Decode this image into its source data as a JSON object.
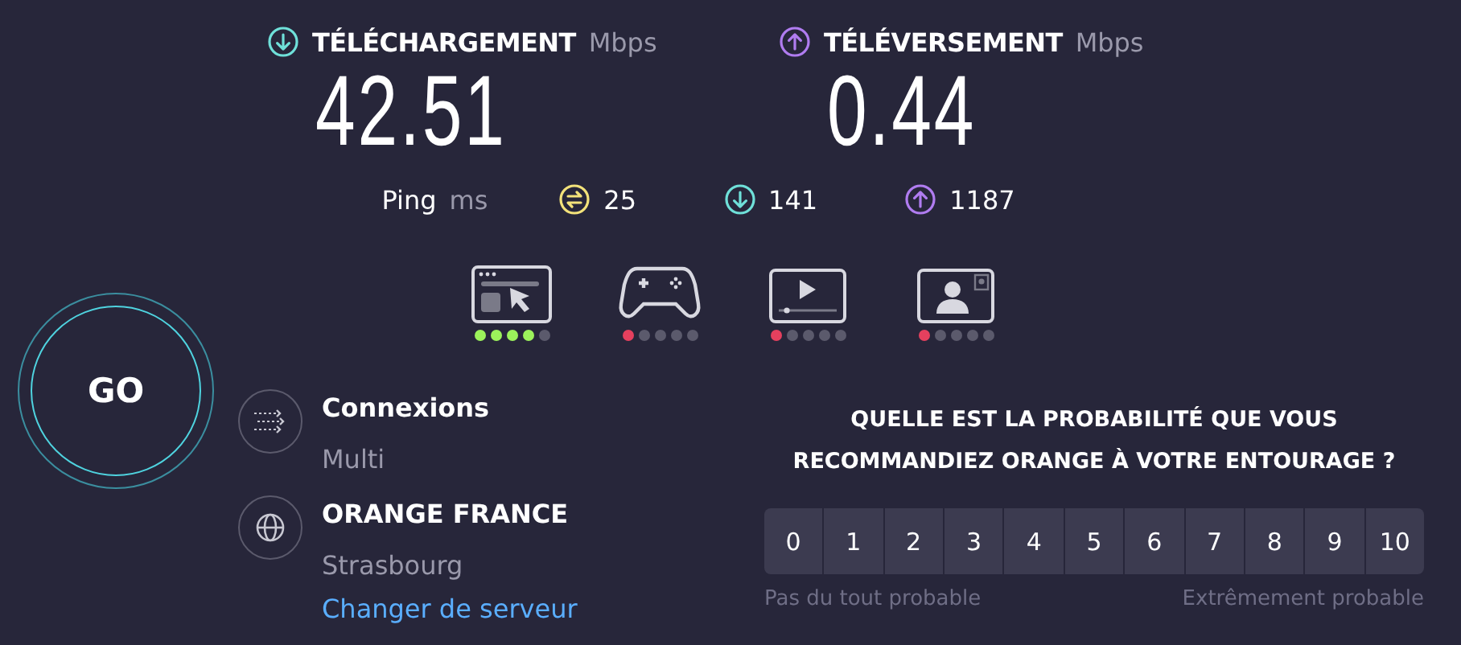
{
  "download": {
    "label": "TÉLÉCHARGEMENT",
    "unit": "Mbps",
    "value": "42.51"
  },
  "upload": {
    "label": "TÉLÉVERSEMENT",
    "unit": "Mbps",
    "value": "0.44"
  },
  "ping": {
    "label": "Ping",
    "unit": "ms",
    "idle": "25",
    "download": "141",
    "upload": "1187"
  },
  "activities": [
    {
      "kind": "browsing",
      "stars": 4,
      "color": "#9cf25b"
    },
    {
      "kind": "gaming",
      "stars": 1,
      "color": "#e5405e"
    },
    {
      "kind": "video",
      "stars": 1,
      "color": "#e5405e"
    },
    {
      "kind": "call",
      "stars": 1,
      "color": "#e5405e"
    }
  ],
  "go_button": "GO",
  "connections": {
    "label": "Connexions",
    "value": "Multi"
  },
  "server": {
    "provider": "ORANGE FRANCE",
    "city": "Strasbourg",
    "change_link": "Changer de serveur"
  },
  "survey": {
    "question": "QUELLE EST LA PROBABILITÉ QUE VOUS RECOMMANDIEZ ORANGE À VOTRE ENTOURAGE ?",
    "scores": [
      {
        "label": "0",
        "selected": false
      },
      {
        "label": "1",
        "selected": false
      },
      {
        "label": "2",
        "selected": false
      },
      {
        "label": "3",
        "selected": false
      },
      {
        "label": "4",
        "selected": false
      },
      {
        "label": "5",
        "selected": false
      },
      {
        "label": "6",
        "selected": false
      },
      {
        "label": "7",
        "selected": false
      },
      {
        "label": "8",
        "selected": false
      },
      {
        "label": "9",
        "selected": false
      },
      {
        "label": "10",
        "selected": false
      }
    ],
    "low_label": "Pas du tout probable",
    "high_label": "Extrêmement probable"
  }
}
